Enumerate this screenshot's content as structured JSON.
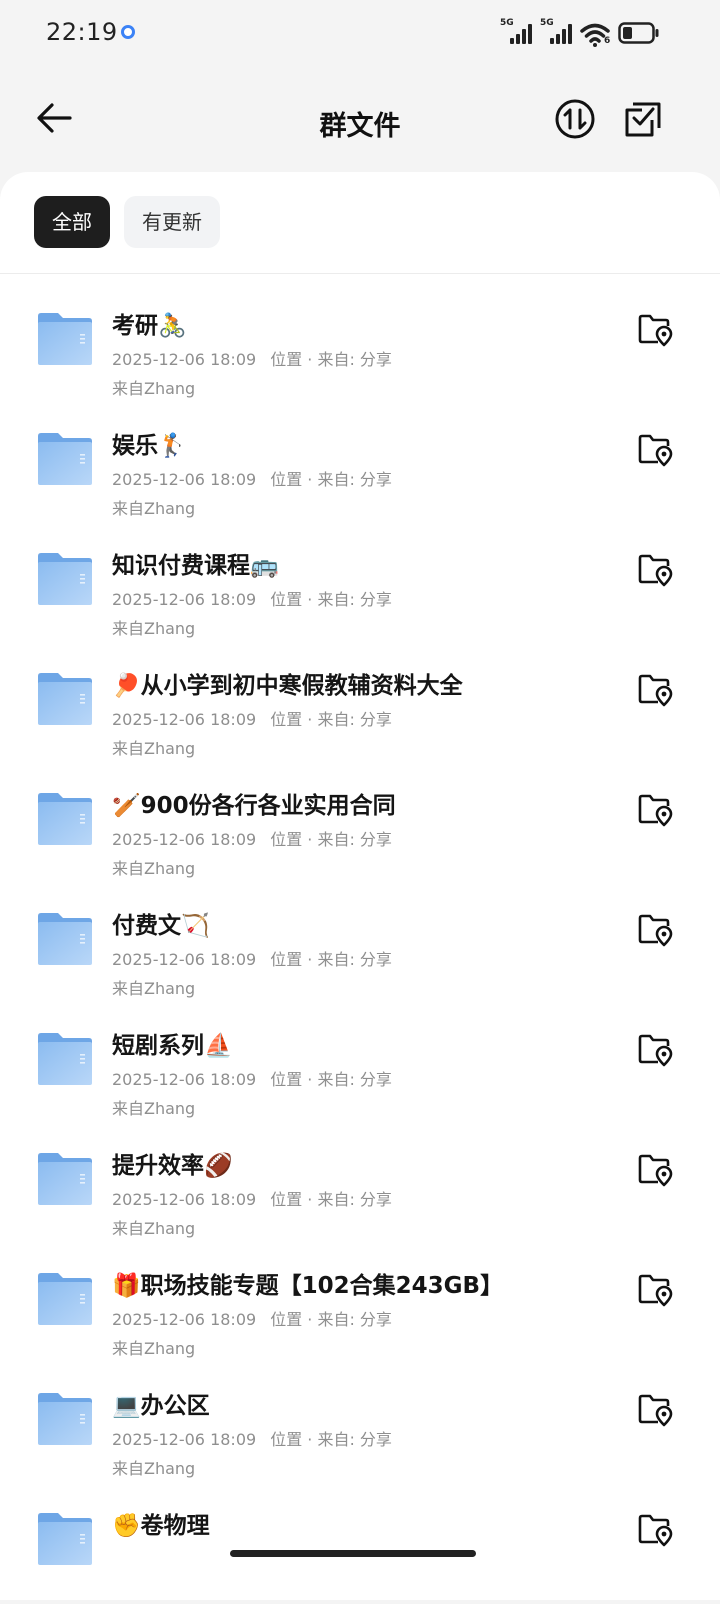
{
  "status_bar": {
    "time": "22:19",
    "sim1_label": "5G",
    "sim2_label": "5G",
    "wifi_label": "6"
  },
  "header": {
    "title": "群文件"
  },
  "tabs": [
    {
      "label": "全部",
      "selected": true
    },
    {
      "label": "有更新",
      "selected": false
    }
  ],
  "folders": [
    {
      "name": "考研🚴",
      "date": "2025-12-06 18:09",
      "location": "位置 · 来自: 分享",
      "owner": "来自Zhang"
    },
    {
      "name": "娱乐🏌",
      "date": "2025-12-06 18:09",
      "location": "位置 · 来自: 分享",
      "owner": "来自Zhang"
    },
    {
      "name": "知识付费课程🚌",
      "date": "2025-12-06 18:09",
      "location": "位置 · 来自: 分享",
      "owner": "来自Zhang"
    },
    {
      "name": "🏓从小学到初中寒假教辅资料大全",
      "date": "2025-12-06 18:09",
      "location": "位置 · 来自: 分享",
      "owner": "来自Zhang"
    },
    {
      "name": "🏏900份各行各业实用合同",
      "date": "2025-12-06 18:09",
      "location": "位置 · 来自: 分享",
      "owner": "来自Zhang"
    },
    {
      "name": "付费文🏹",
      "date": "2025-12-06 18:09",
      "location": "位置 · 来自: 分享",
      "owner": "来自Zhang"
    },
    {
      "name": "短剧系列⛵",
      "date": "2025-12-06 18:09",
      "location": "位置 · 来自: 分享",
      "owner": "来自Zhang"
    },
    {
      "name": "提升效率🏈",
      "date": "2025-12-06 18:09",
      "location": "位置 · 来自: 分享",
      "owner": "来自Zhang"
    },
    {
      "name": "🎁职场技能专题【102合集243GB】",
      "date": "2025-12-06 18:09",
      "location": "位置 · 来自: 分享",
      "owner": "来自Zhang"
    },
    {
      "name": "💻办公区",
      "date": "2025-12-06 18:09",
      "location": "位置 · 来自: 分享",
      "owner": "来自Zhang"
    },
    {
      "name": "✊卷物理",
      "date": "",
      "location": "",
      "owner": ""
    }
  ],
  "icons": {
    "back": "arrow-left-icon",
    "sort": "sort-arrows-icon",
    "select": "checkbox-multi-select-icon",
    "folder": "folder-icon",
    "locate": "folder-location-icon"
  },
  "colors": {
    "folder_blue": "#7fb2ea",
    "selected_tab": "#1e1e1e",
    "meta_gray": "#8f8f8f"
  }
}
